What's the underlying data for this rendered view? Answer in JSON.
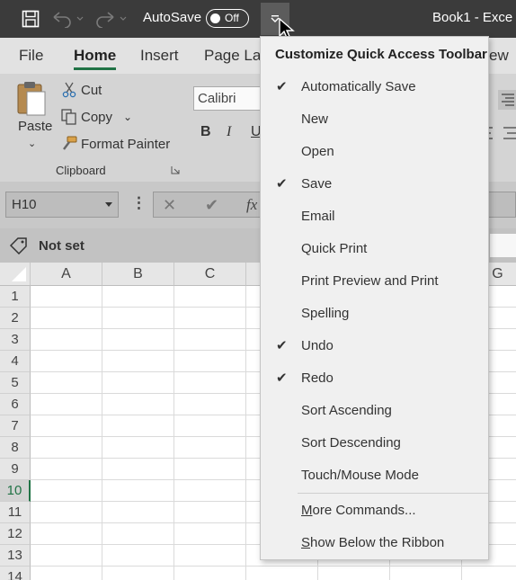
{
  "titlebar": {
    "autosave_label": "AutoSave",
    "autosave_state": "Off",
    "doc_title": "Book1  -  Exce"
  },
  "tabs": [
    "File",
    "Home",
    "Insert",
    "Page Lay",
    "ew"
  ],
  "ribbon": {
    "paste": "Paste",
    "cut": "Cut",
    "copy": "Copy",
    "format_painter": "Format Painter",
    "group_label": "Clipboard",
    "font_name": "Calibri",
    "bold": "B",
    "italic": "I",
    "underline": "U"
  },
  "formula_bar": {
    "name_box": "H10",
    "more": "⋮",
    "cancel": "✕",
    "enter": "✔",
    "fx": "fx"
  },
  "sensitivity": {
    "label": "Not set"
  },
  "grid": {
    "columns": [
      "A",
      "B",
      "C",
      "G"
    ],
    "rows": [
      "1",
      "2",
      "3",
      "4",
      "5",
      "6",
      "7",
      "8",
      "9",
      "10",
      "11",
      "12",
      "13",
      "14"
    ],
    "active_row": "10"
  },
  "menu": {
    "title": "Customize Quick Access Toolbar",
    "items": [
      {
        "label": "Automatically Save",
        "checked": true
      },
      {
        "label": "New",
        "checked": false
      },
      {
        "label": "Open",
        "checked": false
      },
      {
        "label": "Save",
        "checked": true
      },
      {
        "label": "Email",
        "checked": false
      },
      {
        "label": "Quick Print",
        "checked": false
      },
      {
        "label": "Print Preview and Print",
        "checked": false
      },
      {
        "label": "Spelling",
        "checked": false
      },
      {
        "label": "Undo",
        "checked": true
      },
      {
        "label": "Redo",
        "checked": true
      },
      {
        "label": "Sort Ascending",
        "checked": false
      },
      {
        "label": "Sort Descending",
        "checked": false
      },
      {
        "label": "Touch/Mouse Mode",
        "checked": false
      }
    ],
    "more_commands": {
      "prefix": "M",
      "rest": "ore Commands..."
    },
    "show_below": {
      "prefix": "S",
      "rest": "how Below the Ribbon"
    },
    "check_glyph": "✔"
  },
  "colors": {
    "accent": "#217346",
    "titlebar": "#3b3b3b"
  }
}
